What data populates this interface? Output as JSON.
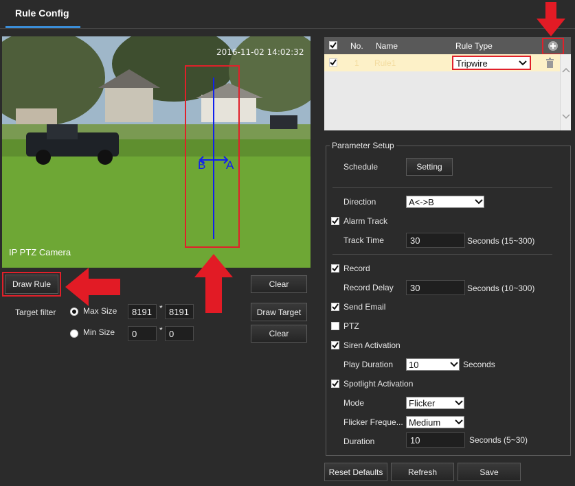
{
  "header": {
    "tab_title": "Rule Config"
  },
  "camera": {
    "timestamp": "2016-11-02 14:02:32",
    "name": "IP PTZ Camera",
    "tripwire_left": "B",
    "tripwire_right": "A"
  },
  "left_controls": {
    "draw_rule": "Draw Rule",
    "clear_rule": "Clear",
    "target_filter_label": "Target filter",
    "max_size_label": "Max Size",
    "max_w": "8191",
    "max_h": "8191",
    "min_size_label": "Min Size",
    "min_w": "0",
    "min_h": "0",
    "size_sep": "*",
    "draw_target": "Draw Target",
    "clear_target": "Clear",
    "max_selected": true
  },
  "rule_table": {
    "headers": {
      "no": "No.",
      "name": "Name",
      "type": "Rule Type"
    },
    "rows": [
      {
        "no": "1",
        "name": "Rule1",
        "type": "Tripwire",
        "checked": true
      }
    ]
  },
  "params": {
    "title": "Parameter Setup",
    "schedule_label": "Schedule",
    "setting_button": "Setting",
    "direction_label": "Direction",
    "direction_value": "A<->B",
    "alarm_track_label": "Alarm Track",
    "track_time_label": "Track Time",
    "track_time_value": "30",
    "track_time_unit": "Seconds (15~300)",
    "record_label": "Record",
    "record_delay_label": "Record Delay",
    "record_delay_value": "30",
    "record_delay_unit": "Seconds (10~300)",
    "send_email_label": "Send Email",
    "ptz_label": "PTZ",
    "siren_label": "Siren Activation",
    "play_duration_label": "Play Duration",
    "play_duration_value": "10",
    "play_duration_unit": "Seconds",
    "spotlight_label": "Spotlight Activation",
    "mode_label": "Mode",
    "mode_value": "Flicker",
    "flicker_freq_label": "Flicker Freque...",
    "flicker_freq_value": "Medium",
    "duration_label": "Duration",
    "duration_value": "10",
    "duration_unit": "Seconds (5~30)"
  },
  "footer": {
    "reset": "Reset Defaults",
    "refresh": "Refresh",
    "save": "Save"
  },
  "colors": {
    "accent": "#3b8ed8",
    "highlight_red": "#e0202a",
    "row_highlight": "#fdf1c8"
  }
}
